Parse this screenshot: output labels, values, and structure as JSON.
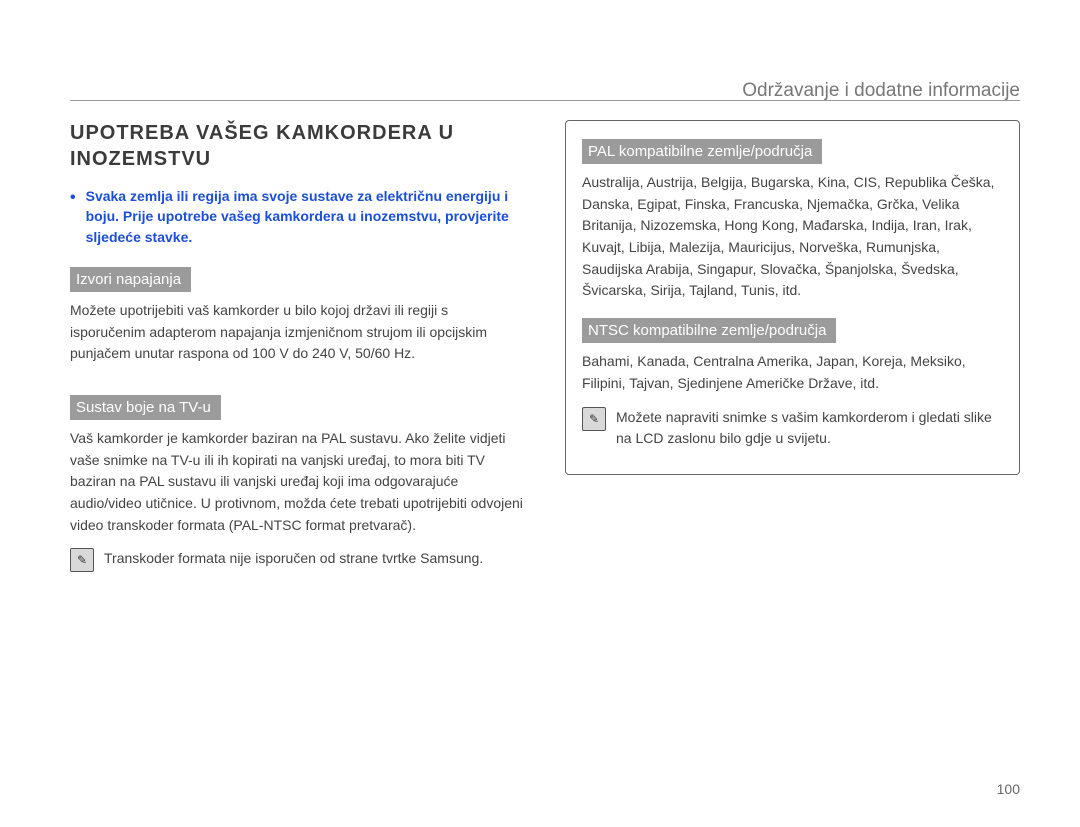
{
  "header": {
    "section_label": "Održavanje i dodatne informacije"
  },
  "left": {
    "title": "UPOTREBA VAŠEG KAMKORDERA U INOZEMSTVU",
    "warn_bullet": "•",
    "warn_text": "Svaka zemlja ili regija ima svoje sustave za električnu energiju i boju. Prije upotrebe vašeg kamkordera u inozemstvu, provjerite sljedeće stavke.",
    "powers_head": "Izvori napajanja",
    "powers_body": "Možete upotrijebiti vaš kamkorder u bilo kojoj državi ili regiji s isporučenim adapterom napajanja izmjeničnom strujom ili opcijskim punjačem unutar raspona od 100 V do 240 V, 50/60 Hz.",
    "tvcolor_head": "Sustav boje na TV-u",
    "tvcolor_body1": "Vaš kamkorder je kamkorder baziran na PAL sustavu. Ako želite vidjeti vaše snimke na TV-u ili ih kopirati na vanjski uređaj, to mora biti TV baziran na PAL sustavu ili vanjski uređaj koji ima odgovarajuće audio/video utičnice. U protivnom, možda ćete trebati upotrijebiti odvojeni video transkoder formata (PAL-NTSC format pretvarač).",
    "note_icon_label": "✎",
    "tvcolor_note": "Transkoder formata nije isporučen od strane tvrtke Samsung."
  },
  "right": {
    "pal_head": "PAL kompatibilne zemlje/područja",
    "pal_body": "Australija, Austrija, Belgija, Bugarska, Kina, CIS, Republika Češka, Danska, Egipat, Finska, Francuska, Njemačka, Grčka, Velika Britanija, Nizozemska, Hong Kong, Mađarska, Indija, Iran, Irak, Kuvajt, Libija, Malezija, Mauricijus, Norveška, Rumunjska, Saudijska Arabija, Singapur, Slovačka, Španjolska, Švedska, Švicarska, Sirija, Tajland, Tunis, itd.",
    "ntsc_head": "NTSC kompatibilne zemlje/područja",
    "ntsc_body": "Bahami, Kanada, Centralna Amerika, Japan, Koreja, Meksiko, Filipini, Tajvan, Sjedinjene Američke Države, itd.",
    "note_icon_label": "✎",
    "box_note": "Možete napraviti snimke s vašim kamkorderom i gledati slike na LCD zaslonu bilo gdje u svijetu."
  },
  "page_number": "100"
}
